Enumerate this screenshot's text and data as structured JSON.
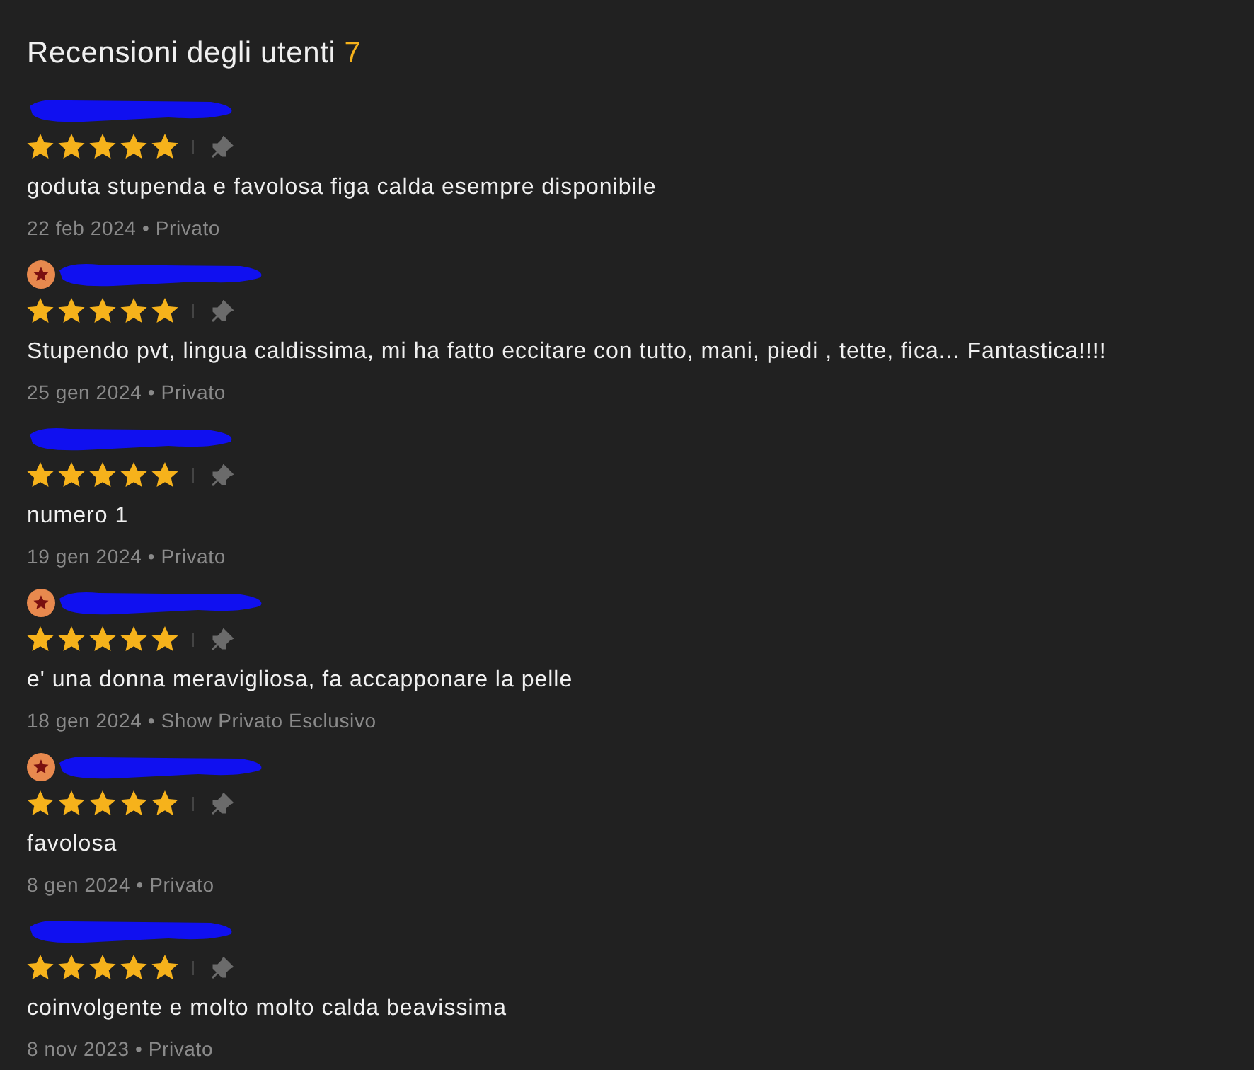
{
  "heading": {
    "title": "Recensioni degli utenti",
    "count": "7"
  },
  "reviews": [
    {
      "badge": false,
      "stars": 5,
      "text": "goduta stupenda e favolosa figa calda esempre disponibile",
      "meta": "22 feb 2024 • Privato"
    },
    {
      "badge": true,
      "stars": 5,
      "text": "Stupendo pvt, lingua caldissima, mi ha fatto eccitare con tutto, mani, piedi , tette, fica... Fantastica!!!!",
      "meta": "25 gen 2024 • Privato"
    },
    {
      "badge": false,
      "stars": 5,
      "text": "numero 1",
      "meta": "19 gen 2024 • Privato"
    },
    {
      "badge": true,
      "stars": 5,
      "text": "e' una donna meravigliosa, fa accapponare la pelle",
      "meta": "18 gen 2024 • Show Privato Esclusivo"
    },
    {
      "badge": true,
      "stars": 5,
      "text": "favolosa",
      "meta": "8 gen 2024 • Privato"
    },
    {
      "badge": false,
      "stars": 5,
      "text": "coinvolgente e molto molto calda beavissima",
      "meta": "8 nov 2023 • Privato"
    }
  ]
}
